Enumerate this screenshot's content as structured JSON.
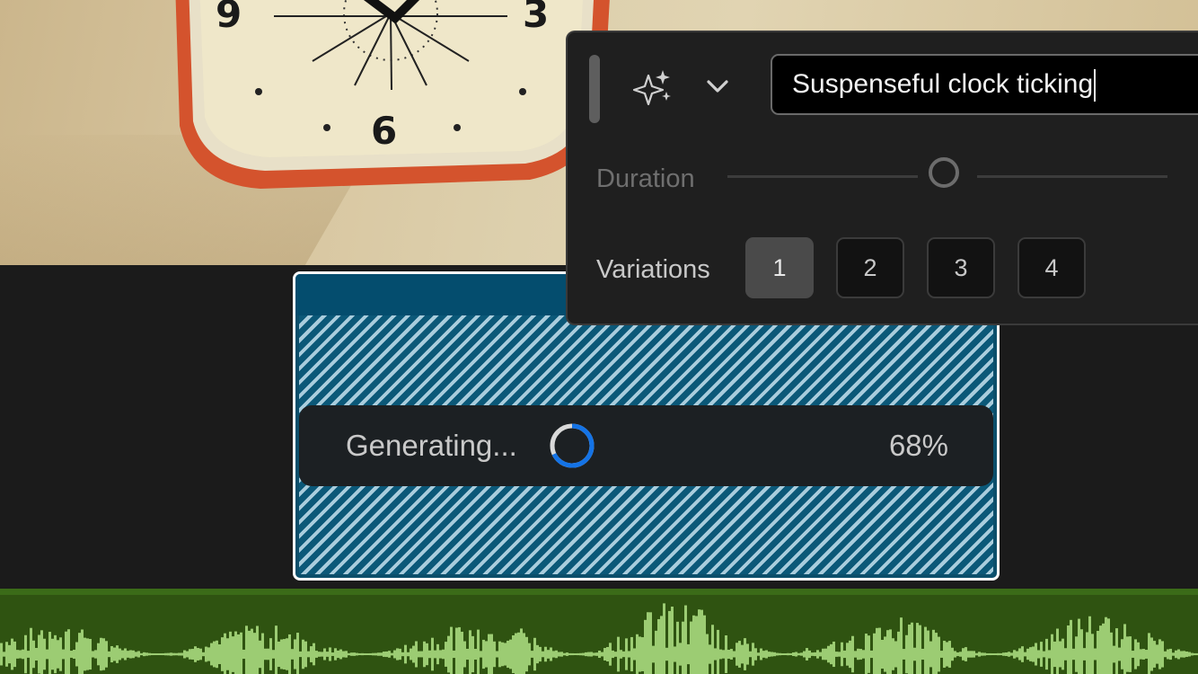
{
  "prompt": {
    "value": "Suspenseful clock ticking"
  },
  "icons": {
    "generate": "sparkle-icon",
    "expand": "chevron-down-icon",
    "drag": "drag-handle"
  },
  "duration": {
    "label": "Duration",
    "level": 0.46
  },
  "variations": {
    "label": "Variations",
    "options": [
      "1",
      "2",
      "3",
      "4"
    ],
    "selected": "1"
  },
  "generation": {
    "status": "Generating...",
    "progress": "68%",
    "progress_value": 0.68
  },
  "colors": {
    "accent": "#1473e6",
    "clip": "#044d6e",
    "audio": "#2f5311",
    "waveform": "#9ccc73"
  }
}
